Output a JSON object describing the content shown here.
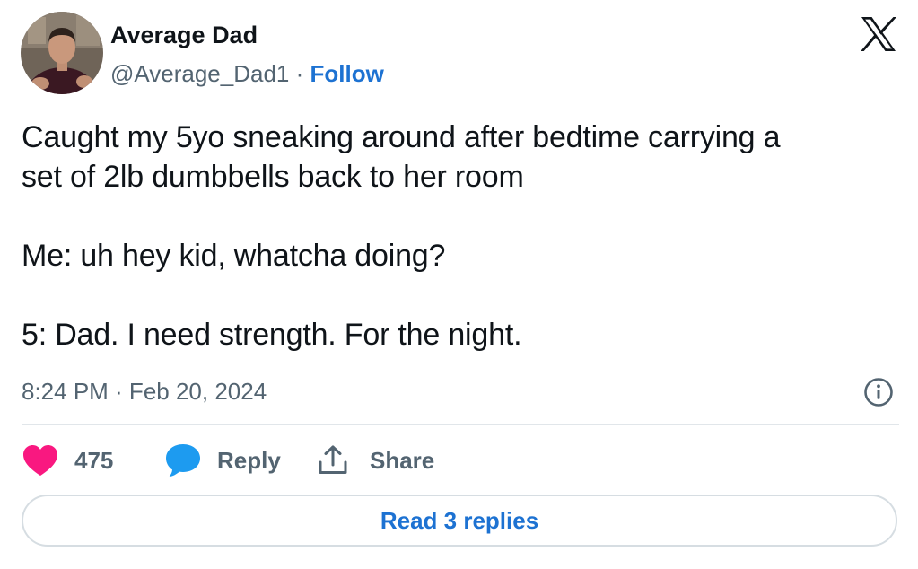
{
  "author": {
    "name": "Average Dad",
    "handle": "@Average_Dad1",
    "separator": " · ",
    "follow_label": "Follow",
    "avatar_icon": "profile-photo"
  },
  "platform": {
    "logo_icon": "x-logo"
  },
  "tweet": {
    "lines": [
      "Caught my 5yo sneaking around after bedtime carrying a",
      "set of 2lb dumbbells back to her room",
      "",
      "Me: uh hey kid, whatcha doing?",
      "",
      "5: Dad. I need strength. For the night."
    ],
    "timestamp": "8:24 PM · Feb 20, 2024"
  },
  "actions": {
    "like": {
      "icon": "heart-icon",
      "color": "#f91880",
      "count": "475"
    },
    "reply": {
      "icon": "speech-bubble-icon",
      "color": "#1d9bf0",
      "label": "Reply"
    },
    "share": {
      "icon": "share-icon",
      "label": "Share"
    }
  },
  "read_replies": {
    "label": "Read 3 replies"
  },
  "colors": {
    "text": "#0f1419",
    "secondary": "#536471",
    "link": "#1d72d2",
    "divider": "#e1e6ea"
  }
}
